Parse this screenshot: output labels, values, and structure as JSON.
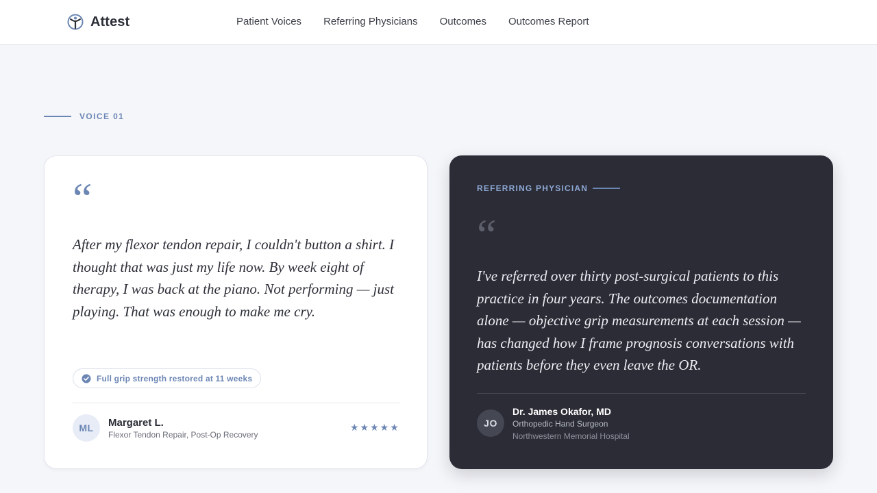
{
  "header": {
    "brand_name": "Attest",
    "brand_icon": "figure-emblem-icon",
    "nav": [
      "Patient Voices",
      "Referring Physicians",
      "Outcomes",
      "Outcomes Report"
    ]
  },
  "section": {
    "eyebrow": "VOICE 01"
  },
  "patient_card": {
    "quote_mark": "“",
    "quote": "After my flexor tendon repair, I couldn't button a shirt. I thought that was just my life now. By week eight of therapy, I was back at the piano. Not performing — just playing. That was enough to make me cry.",
    "badge": "Full grip strength restored at 11 weeks",
    "badge_icon": "check-circle-icon",
    "avatar_initials": "ML",
    "name": "Margaret L.",
    "role": "Flexor Tendon Repair, Post-Op Recovery",
    "rating_display": "★★★★★",
    "rating": 5
  },
  "physician_card": {
    "eyebrow": "REFERRING PHYSICIAN",
    "quote_mark": "“",
    "quote": "I've referred over thirty post-surgical patients to this practice in four years. The outcomes documentation alone — objective grip measurements at each session — has changed how I frame prognosis conversations with patients before they even leave the OR.",
    "avatar_initials": "JO",
    "name": "Dr. James Okafor, MD",
    "role": "Orthopedic Hand Surgeon",
    "organization": "Northwestern Memorial Hospital"
  },
  "colors": {
    "accent": "#6c86b4",
    "dark_card": "#2b2c35",
    "page_background": "#f5f6fa"
  }
}
